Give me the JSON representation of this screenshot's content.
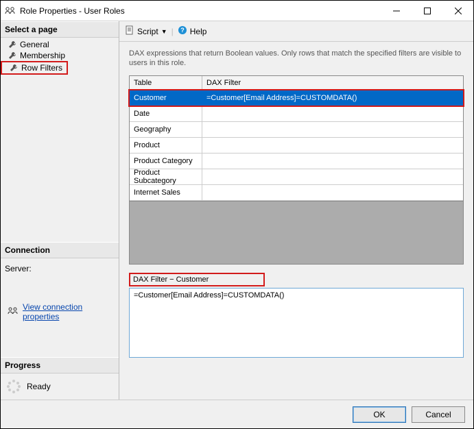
{
  "window": {
    "title": "Role Properties - User Roles"
  },
  "sidebar": {
    "select_page": "Select a page",
    "pages": [
      {
        "label": "General"
      },
      {
        "label": "Membership"
      },
      {
        "label": "Row Filters"
      }
    ],
    "connection_header": "Connection",
    "server_label": "Server:",
    "view_conn_props": "View connection properties",
    "progress_header": "Progress",
    "ready": "Ready"
  },
  "toolbar": {
    "script": "Script",
    "help": "Help"
  },
  "main": {
    "description": "DAX expressions that return Boolean values. Only rows that match the specified filters are visible to users in this role.",
    "col_table": "Table",
    "col_filter": "DAX Filter",
    "rows": [
      {
        "table": "Customer",
        "filter": "=Customer[Email Address]=CUSTOMDATA()",
        "selected": true
      },
      {
        "table": "Date",
        "filter": ""
      },
      {
        "table": "Geography",
        "filter": ""
      },
      {
        "table": "Product",
        "filter": ""
      },
      {
        "table": "Product Category",
        "filter": ""
      },
      {
        "table": "Product Subcategory",
        "filter": ""
      },
      {
        "table": "Internet Sales",
        "filter": ""
      }
    ],
    "filter_label": "DAX Filter − Customer",
    "filter_value": "=Customer[Email Address]=CUSTOMDATA()"
  },
  "footer": {
    "ok": "OK",
    "cancel": "Cancel"
  }
}
